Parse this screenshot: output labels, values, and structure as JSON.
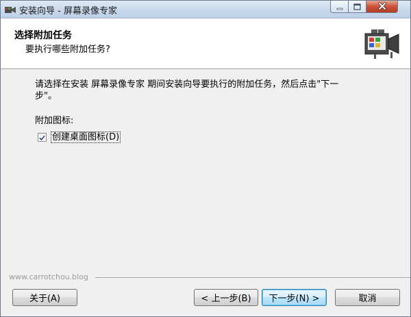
{
  "window": {
    "title": "安装向导 - 屏幕录像专家"
  },
  "header": {
    "title": "选择附加任务",
    "subtitle": "要执行哪些附加任务?"
  },
  "body": {
    "instruction_line1": "请选择在安装 屏幕录像专家 期间安装向导要执行的附加任务，然后点击\"下一",
    "instruction_line2": "步\"。",
    "group_label": "附加图标:",
    "checkbox_label": "创建桌面图标(D)",
    "checkbox_checked": true
  },
  "footer": {
    "watermark": "www.carrotchou.blog",
    "about_button": "关于(A)",
    "back_button": "< 上一步(B)",
    "next_button": "下一步(N) >",
    "cancel_button": "取消"
  }
}
